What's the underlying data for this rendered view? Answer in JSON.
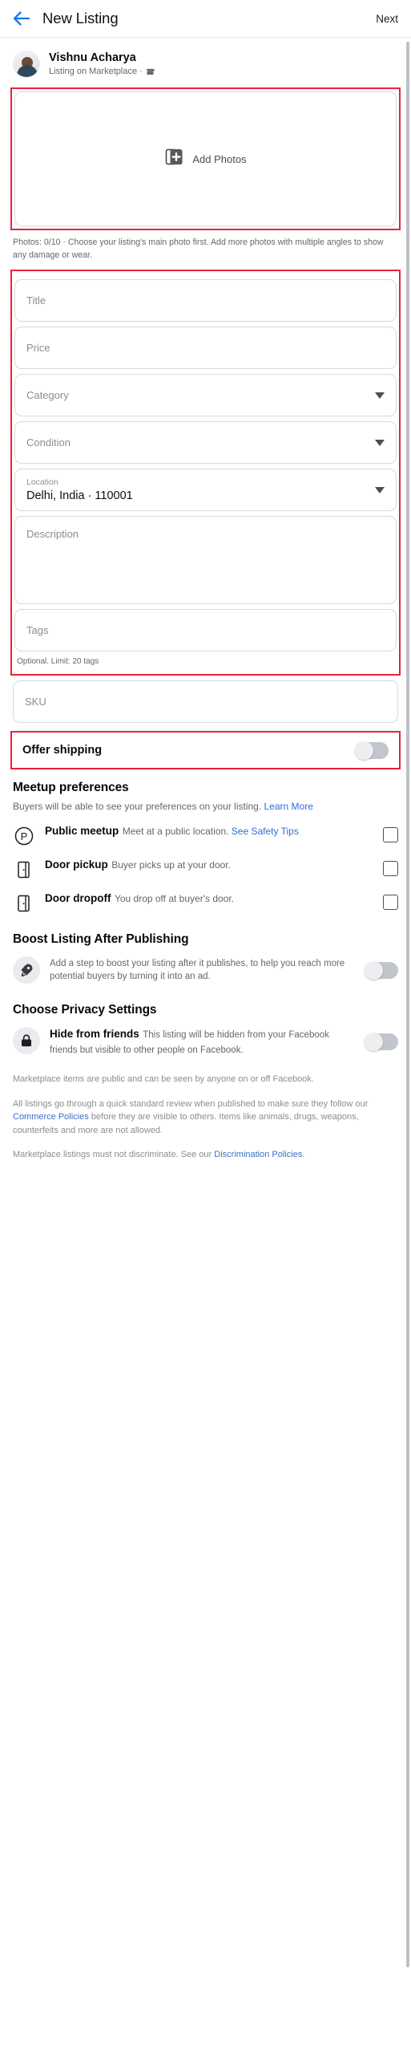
{
  "header": {
    "back_icon": "back-arrow-icon",
    "title": "New Listing",
    "next_label": "Next"
  },
  "profile": {
    "name": "Vishnu Acharya",
    "subtitle": "Listing on Marketplace ·",
    "store_icon": "store-icon"
  },
  "photos": {
    "add_label": "Add Photos",
    "add_icon": "add-photos-icon",
    "note": "Photos: 0/10 · Choose your listing's main photo first. Add more photos with multiple angles to show any damage or wear."
  },
  "form": {
    "title": {
      "placeholder": "Title",
      "value": ""
    },
    "price": {
      "placeholder": "Price",
      "value": ""
    },
    "category": {
      "placeholder": "Category",
      "value": ""
    },
    "condition": {
      "placeholder": "Condition",
      "value": ""
    },
    "location": {
      "label": "Location",
      "value": "Delhi, India · 110001"
    },
    "description": {
      "placeholder": "Description",
      "value": ""
    },
    "tags": {
      "placeholder": "Tags",
      "value": "",
      "note": "Optional. Limit: 20 tags"
    },
    "sku": {
      "placeholder": "SKU",
      "value": ""
    }
  },
  "shipping": {
    "label": "Offer shipping",
    "toggle_state": "off"
  },
  "meetup": {
    "title": "Meetup preferences",
    "desc": "Buyers will be able to see your preferences on your listing. ",
    "learn_more": "Learn More",
    "options": [
      {
        "icon": "public-meetup-parking-icon",
        "title": "Public meetup",
        "sub": "Meet at a public location. ",
        "link": "See Safety Tips",
        "checked": false
      },
      {
        "icon": "door-pickup-icon",
        "title": "Door pickup",
        "sub": "Buyer picks up at your door.",
        "link": "",
        "checked": false
      },
      {
        "icon": "door-dropoff-icon",
        "title": "Door dropoff",
        "sub": "You drop off at buyer's door.",
        "link": "",
        "checked": false
      }
    ]
  },
  "boost": {
    "title": "Boost Listing After Publishing",
    "icon": "rocket-icon",
    "desc": "Add a step to boost your listing after it publishes, to help you reach more potential buyers by turning it into an ad.",
    "toggle_state": "off"
  },
  "privacy": {
    "title": "Choose Privacy Settings",
    "icon": "lock-icon",
    "option_title": "Hide from friends",
    "option_desc": "This listing will be hidden from your Facebook friends but visible to other people on Facebook.",
    "toggle_state": "off"
  },
  "legal": {
    "p1": "Marketplace items are public and can be seen by anyone on or off Facebook.",
    "p2_a": "All listings go through a quick standard review when published to make sure they follow our ",
    "p2_link": "Commerce Policies",
    "p2_b": " before they are visible to others. Items like animals, drugs, weapons, counterfeits and more are not allowed.",
    "p3_a": "Marketplace listings must not discriminate. See our ",
    "p3_link": "Discrimination Policies",
    "p3_b": "."
  },
  "colors": {
    "accent_blue": "#1877f2",
    "link_blue": "#2e6dd4",
    "highlight_red": "#e8243a",
    "text_secondary": "#65676b"
  }
}
